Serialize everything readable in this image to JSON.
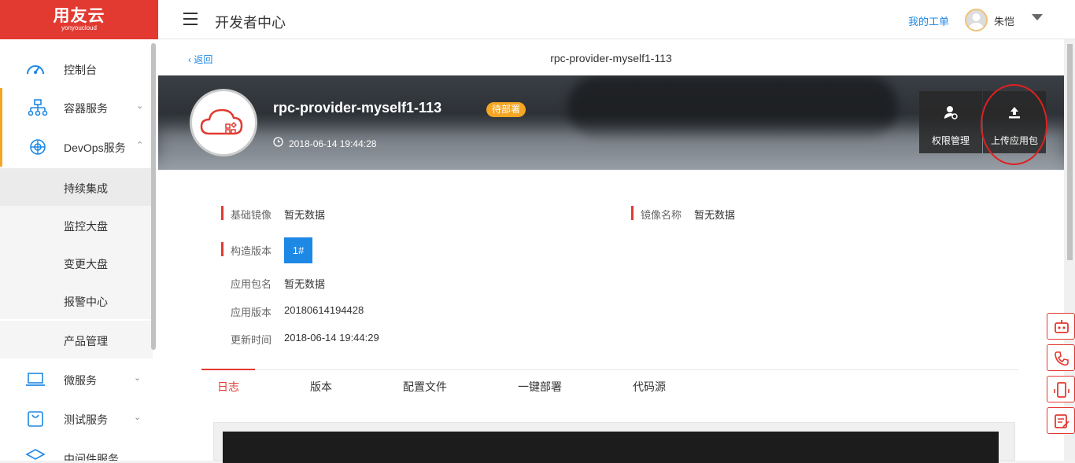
{
  "brand": {
    "name": "用友云",
    "sub": "yonyoucloud",
    "color": "#e23a31"
  },
  "header": {
    "title": "开发者中心",
    "my_ticket": "我的工单",
    "user": "朱恺"
  },
  "sidebar": {
    "items": [
      {
        "label": "控制台",
        "icon": "dashboard-icon"
      },
      {
        "label": "容器服务",
        "icon": "network-icon"
      },
      {
        "label": "DevOps服务",
        "icon": "aperture-icon"
      },
      {
        "label": "微服务",
        "icon": "laptop-icon"
      },
      {
        "label": "测试服务",
        "icon": "shopping-bag-icon"
      },
      {
        "label": "中间件服务",
        "icon": "layers-icon"
      }
    ],
    "subitems": [
      "持续集成",
      "监控大盘",
      "变更大盘",
      "报警中心",
      "产品管理"
    ]
  },
  "page": {
    "back": "返回",
    "title": "rpc-provider-myself1-113"
  },
  "banner": {
    "app_name": "rpc-provider-myself1-113",
    "status": "待部署",
    "created": "2018-06-14 19:44:28",
    "perm_button": "权限管理",
    "upload_button": "上传应用包"
  },
  "info": {
    "base_image_k": "基础镜像",
    "base_image_v": "暂无数据",
    "image_name_k": "镜像名称",
    "image_name_v": "暂无数据",
    "build_version_k": "构造版本",
    "build_version_v": "1#",
    "package_name_k": "应用包名",
    "package_name_v": "暂无数据",
    "app_version_k": "应用版本",
    "app_version_v": "20180614194428",
    "updated_k": "更新时间",
    "updated_v": "2018-06-14 19:44:29"
  },
  "tabs": [
    "日志",
    "版本",
    "配置文件",
    "一键部署",
    "代码源"
  ],
  "colors": {
    "accent": "#e23a31",
    "link": "#1e88e5",
    "badge": "#f5a623"
  }
}
